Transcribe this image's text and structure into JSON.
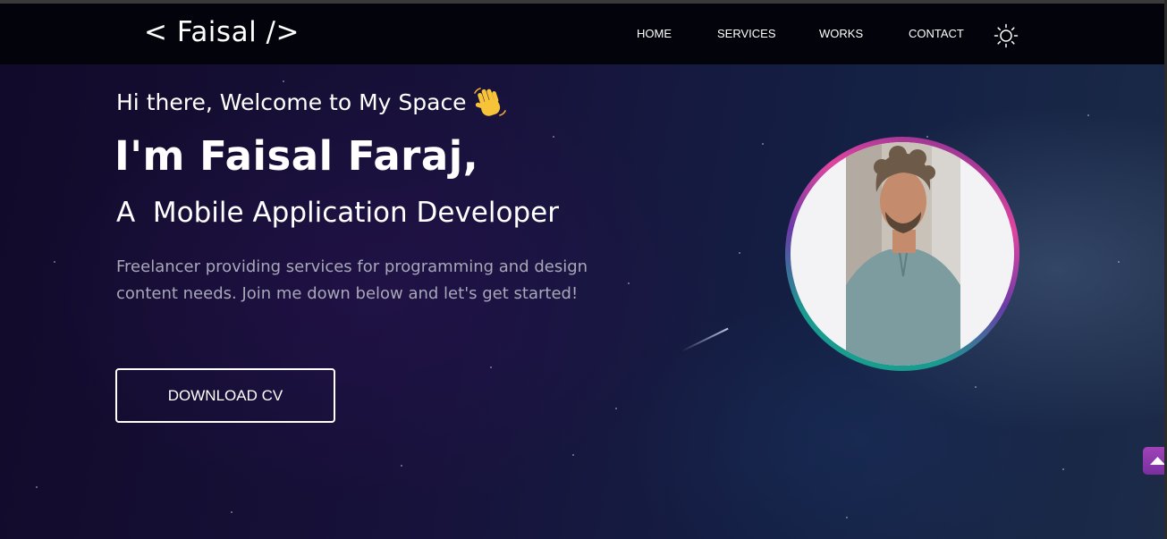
{
  "nav": {
    "logo": "< Faisal />",
    "links": [
      "HOME",
      "SERVICES",
      "WORKS",
      "CONTACT"
    ],
    "theme_icon": "sun-icon"
  },
  "hero": {
    "greeting": "Hi there, Welcome to My Space",
    "wave_icon": "waving-hand-icon",
    "name": "I'm Faisal Faraj,",
    "role": "A  Mobile Application Developer",
    "description": "Freelancer providing services for programming and design content needs. Join me down below and let's get started!",
    "cta_label": "DOWNLOAD CV"
  },
  "avatar": {
    "icon": "profile-photo"
  },
  "scroll_top": {
    "icon": "arrow-up-icon"
  },
  "colors": {
    "background": "#0b0b1f",
    "navbar": "#03030b",
    "text": "#ffffff",
    "muted_text": "#a8a8b8",
    "ring_pink": "#e0459f",
    "ring_teal": "#14a08f",
    "scroll_button": "#a042b8"
  }
}
